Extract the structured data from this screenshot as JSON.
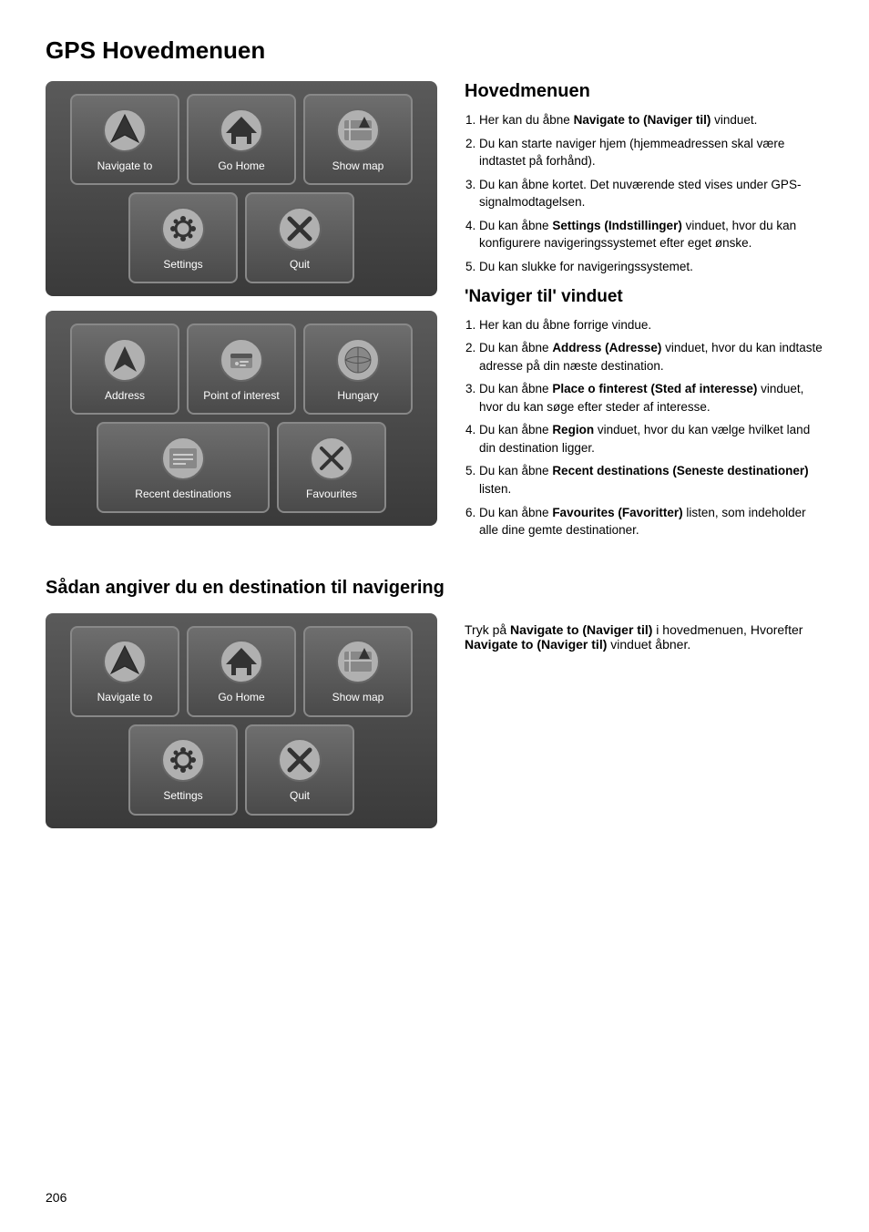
{
  "page": {
    "title": "GPS Hovedmenuen",
    "page_number": "206"
  },
  "menu1": {
    "buttons": [
      {
        "label": "Navigate to",
        "icon": "navigate-to"
      },
      {
        "label": "Go Home",
        "icon": "go-home"
      },
      {
        "label": "Show map",
        "icon": "show-map"
      },
      {
        "label": "Settings",
        "icon": "settings"
      },
      {
        "label": "Quit",
        "icon": "quit"
      }
    ]
  },
  "menu2": {
    "buttons": [
      {
        "label": "Address",
        "icon": "address"
      },
      {
        "label": "Point of\ninterest",
        "icon": "point-of-interest"
      },
      {
        "label": "Hungary",
        "icon": "hungary"
      },
      {
        "label": "Recent destinations",
        "icon": "recent-destinations"
      },
      {
        "label": "Favourites",
        "icon": "favourites"
      }
    ]
  },
  "menu3": {
    "buttons": [
      {
        "label": "Navigate to",
        "icon": "navigate-to"
      },
      {
        "label": "Go Home",
        "icon": "go-home"
      },
      {
        "label": "Show map",
        "icon": "show-map"
      },
      {
        "label": "Settings",
        "icon": "settings"
      },
      {
        "label": "Quit",
        "icon": "quit"
      }
    ]
  },
  "section_hovedmenuen": {
    "heading": "Hovedmenuen",
    "items": [
      "Her kan du åbne <b>Navigate to (Naviger til)</b> vinduet.",
      "Du kan starte naviger hjem (hjemmeadressen skal være indtastet på forhånd).",
      "Du kan åbne kortet. Det nuværende sted vises under GPS-signalmodtagelsen.",
      "Du kan åbne <b>Settings (Indstillinger)</b> vinduet, hvor du kan konfigurere navigeringssystemet efter eget ønske.",
      "Du kan slukke for navigeringssystemet."
    ]
  },
  "section_naviger_til": {
    "heading": "'Naviger til' vinduet",
    "items": [
      "Her kan du åbne forrige vindue.",
      "Du kan åbne <b>Address (Adresse)</b> vinduet, hvor du kan indtaste adresse på din næste destination.",
      "Du kan åbne <b>Place o finterest (Sted af interesse)</b> vinduet, hvor du kan søge efter steder af interesse.",
      "Du kan åbne <b>Region</b> vinduet, hvor du kan vælge hvilket land din destination ligger.",
      "Du kan åbne <b>Recent destinations (Seneste destinationer)</b> listen.",
      "Du kan åbne <b>Favourites (Favoritter)</b> listen, som indeholder alle dine gemte destinationer."
    ]
  },
  "section_saadan": {
    "heading": "Sådan angiver du en destination til navigering",
    "text": "Tryk på <b>Navigate to (Naviger til)</b> i hovedmenuen, Hvorefter <b>Navigate to (Naviger til)</b> vinduet åbner."
  }
}
